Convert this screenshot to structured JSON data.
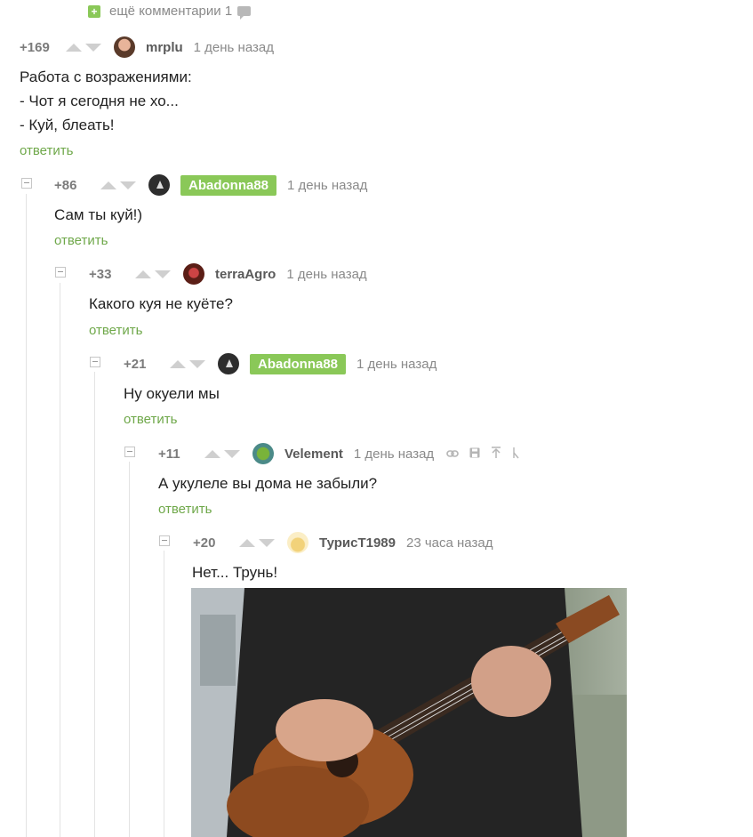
{
  "more_comments": {
    "label": "ещё комментарии 1"
  },
  "comments": [
    {
      "rating": "+169",
      "user": "mrplu",
      "time": "1 день назад",
      "lines": [
        "Работа с возражениями:",
        "- Чот я сегодня не хо...",
        "- Куй, блеать!"
      ],
      "reply": "ответить"
    },
    {
      "rating": "+86",
      "user": "Abadonna88",
      "time": "1 день назад",
      "lines": [
        "Сам ты куй!)"
      ],
      "reply": "ответить"
    },
    {
      "rating": "+33",
      "user": "terraAgro",
      "time": "1 день назад",
      "lines": [
        "Какого куя не куёте?"
      ],
      "reply": "ответить"
    },
    {
      "rating": "+21",
      "user": "Abadonna88",
      "time": "1 день назад",
      "lines": [
        "Ну окуели мы"
      ],
      "reply": "ответить"
    },
    {
      "rating": "+11",
      "user": "Velement",
      "time": "1 день назад",
      "lines": [
        "А укулеле вы дома не забыли?"
      ],
      "reply": "ответить"
    },
    {
      "rating": "+20",
      "user": "ТурисТ1989",
      "time": "23 часа назад",
      "lines": [
        "Нет... Трунь!"
      ]
    }
  ],
  "icons": {
    "expand": "plus-icon",
    "comment": "comment-bubble-icon",
    "collapse": "minus-icon",
    "upvote": "arrow-up-icon",
    "downvote": "arrow-down-icon",
    "link": "link-icon",
    "save": "save-icon",
    "up": "scroll-up-icon",
    "branch": "branch-icon"
  },
  "colors": {
    "accent": "#8ac858",
    "reply_link": "#6fa84a",
    "muted": "#8a8a8a"
  }
}
